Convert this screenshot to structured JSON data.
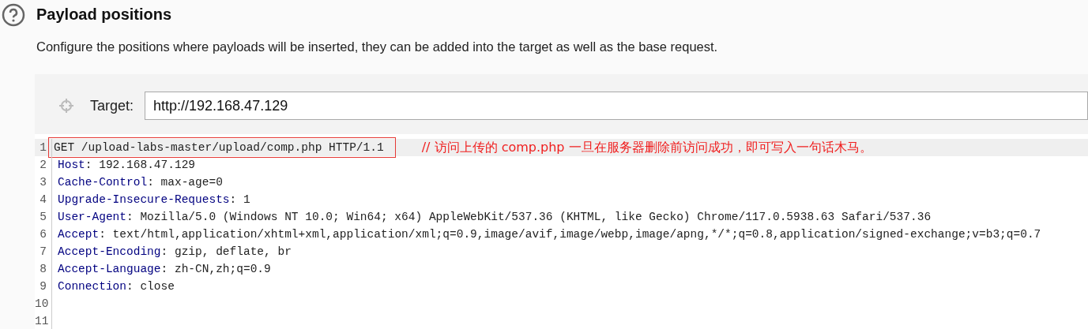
{
  "section": {
    "title": "Payload positions",
    "description": "Configure the positions where payloads will be inserted, they can be added into the target as well as the base request."
  },
  "target": {
    "label": "Target:",
    "value": "http://192.168.47.129"
  },
  "editor": {
    "lines": [
      {
        "number": "1",
        "kind": "request",
        "text": "GET /upload-labs-master/upload/comp.php HTTP/1.1",
        "highlighted": true,
        "boxed": true,
        "annotation": "// 访问上传的 comp.php 一旦在服务器删除前访问成功，即可写入一句话木马。"
      },
      {
        "number": "2",
        "kind": "header",
        "name": "Host",
        "value": ": 192.168.47.129",
        "highlighted": false,
        "boxed": false
      },
      {
        "number": "3",
        "kind": "header",
        "name": "Cache-Control",
        "value": ": max-age=0",
        "highlighted": false,
        "boxed": false
      },
      {
        "number": "4",
        "kind": "header",
        "name": "Upgrade-Insecure-Requests",
        "value": ": 1",
        "highlighted": false,
        "boxed": false
      },
      {
        "number": "5",
        "kind": "header",
        "name": "User-Agent",
        "value": ": Mozilla/5.0 (Windows NT 10.0; Win64; x64) AppleWebKit/537.36 (KHTML, like Gecko) Chrome/117.0.5938.63 Safari/537.36",
        "highlighted": false,
        "boxed": false
      },
      {
        "number": "6",
        "kind": "header",
        "name": "Accept",
        "value": ": text/html,application/xhtml+xml,application/xml;q=0.9,image/avif,image/webp,image/apng,*/*;q=0.8,application/signed-exchange;v=b3;q=0.7",
        "highlighted": false,
        "boxed": false
      },
      {
        "number": "7",
        "kind": "header",
        "name": "Accept-Encoding",
        "value": ": gzip, deflate, br",
        "highlighted": false,
        "boxed": false
      },
      {
        "number": "8",
        "kind": "header",
        "name": "Accept-Language",
        "value": ": zh-CN,zh;q=0.9",
        "highlighted": false,
        "boxed": false
      },
      {
        "number": "9",
        "kind": "header",
        "name": "Connection",
        "value": ": close",
        "highlighted": false,
        "boxed": false
      },
      {
        "number": "10",
        "kind": "blank",
        "highlighted": false
      },
      {
        "number": "11",
        "kind": "blank",
        "highlighted": false
      }
    ]
  }
}
